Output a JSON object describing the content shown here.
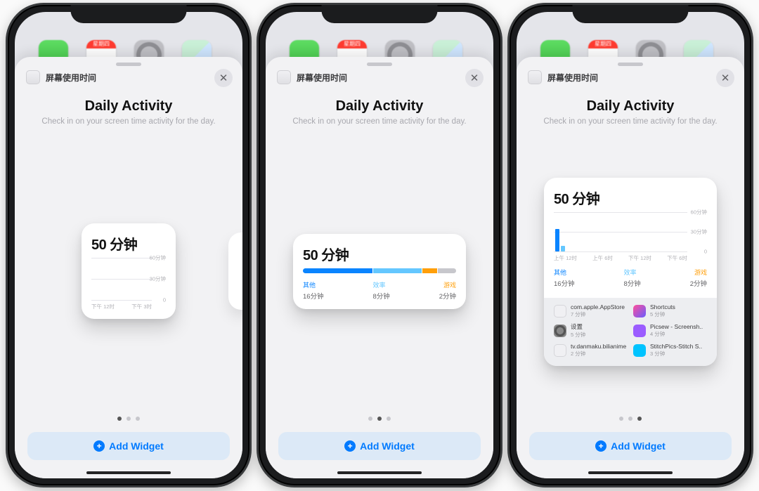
{
  "sheet": {
    "app_name": "屏幕使用时间",
    "title": "Daily Activity",
    "subtitle": "Check in on your screen time activity for the day.",
    "add_button": "Add Widget"
  },
  "home_calendar_label": "星期四",
  "widget_small": {
    "total": "50 分钟",
    "y_ticks": [
      "60分钟",
      "30分钟",
      "0"
    ],
    "x_ticks": [
      "下午 12时",
      "下午 3时"
    ]
  },
  "widget_medium": {
    "total": "50 分钟",
    "segments": [
      {
        "name": "其他",
        "value": "16分钟",
        "color": "#0a84ff",
        "pct": 46
      },
      {
        "name": "效率",
        "value": "8分钟",
        "color": "#64c7ff",
        "pct": 32
      },
      {
        "name": "游戏",
        "value": "2分钟",
        "color": "#ff9f0a",
        "pct": 10
      }
    ],
    "remainder_pct": 12
  },
  "widget_large": {
    "total": "50 分钟",
    "y_ticks": [
      "60分钟",
      "30分钟",
      "0"
    ],
    "x_ticks": [
      "上午 12时",
      "上午 6时",
      "下午 12时",
      "下午 6时"
    ],
    "categories": [
      {
        "name": "其他",
        "value": "16分钟",
        "color": "#0a84ff"
      },
      {
        "name": "效率",
        "value": "8分钟",
        "color": "#64c7ff"
      },
      {
        "name": "游戏",
        "value": "2分钟",
        "color": "#ff9f0a"
      }
    ],
    "apps": [
      {
        "name": "com.apple.AppStore",
        "time": "7 分钟",
        "icon": "ic-appstore"
      },
      {
        "name": "Shortcuts",
        "time": "5 分钟",
        "icon": "ic-shortcuts"
      },
      {
        "name": "设置",
        "time": "5 分钟",
        "icon": "ic-settings"
      },
      {
        "name": "Picsew - Screensh..",
        "time": "4 分钟",
        "icon": "ic-picsew"
      },
      {
        "name": "tv.danmaku.bilianime",
        "time": "2 分钟",
        "icon": "ic-bili"
      },
      {
        "name": "StitchPics-Stitch S..",
        "time": "3 分钟",
        "icon": "ic-stitch"
      }
    ]
  },
  "pager": {
    "count": 3
  },
  "chart_data": [
    {
      "type": "bar",
      "title": "50 分钟",
      "x": [
        "下午 12时",
        "下午 3时"
      ],
      "ylim": [
        0,
        60
      ],
      "y_ticks": [
        0,
        30,
        60
      ],
      "y_unit": "分钟",
      "series": [],
      "note": "small widget hourly chart, no bars visible in screenshot"
    },
    {
      "type": "bar",
      "orientation": "horizontal-stacked",
      "title": "50 分钟",
      "categories": [
        "其他",
        "效率",
        "游戏",
        "(unused)"
      ],
      "values_minutes": [
        16,
        8,
        2,
        0
      ],
      "segment_percent": [
        46,
        32,
        10,
        12
      ],
      "colors": [
        "#0a84ff",
        "#64c7ff",
        "#ff9f0a",
        "#c7c7cc"
      ]
    },
    {
      "type": "bar",
      "title": "50 分钟",
      "x": [
        "上午 12时",
        "上午 6时",
        "下午 12时",
        "下午 6时"
      ],
      "ylim": [
        0,
        60
      ],
      "y_ticks": [
        0,
        30,
        60
      ],
      "y_unit": "分钟",
      "series": [
        {
          "name": "其他",
          "color": "#0a84ff",
          "values": [
            35,
            0,
            0,
            0
          ]
        },
        {
          "name": "效率",
          "color": "#64c7ff",
          "values": [
            8,
            0,
            0,
            0
          ]
        }
      ],
      "category_totals": {
        "其他": 16,
        "效率": 8,
        "游戏": 2
      }
    }
  ]
}
